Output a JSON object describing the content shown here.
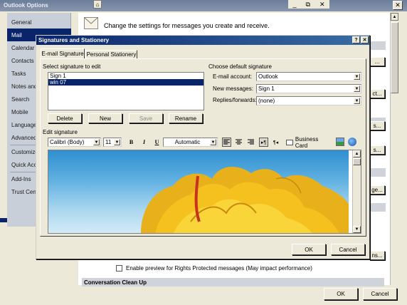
{
  "outer": {
    "title": "Outlook Options",
    "header_text": "Change the settings for messages you create and receive.",
    "nav": [
      "General",
      "Mail",
      "Calendar",
      "Contacts",
      "Tasks",
      "Notes and Journal",
      "Search",
      "Mobile",
      "Language",
      "Advanced",
      "Customize Ribbon",
      "Quick Access Toolbar",
      "Add-Ins",
      "Trust Center"
    ],
    "preview_label": "Enable preview for Rights Protected messages (May impact performance)",
    "section_cleanup": "Conversation Clean Up",
    "ok": "OK",
    "cancel": "Cancel",
    "right_buttons": [
      "...",
      "ct...",
      "s...",
      "s...",
      "ge...",
      "ns..."
    ]
  },
  "dialog": {
    "title": "Signatures and Stationery",
    "tabs": [
      "E-mail Signature",
      "Personal Stationery"
    ],
    "select_label": "Select signature to edit",
    "signatures": [
      "Sign 1",
      "win 07"
    ],
    "selected_index": 1,
    "buttons": {
      "delete": "Delete",
      "new": "New",
      "save": "Save",
      "rename": "Rename"
    },
    "default_label": "Choose default signature",
    "email_account_label": "E-mail account:",
    "email_account_value": "Outlook",
    "new_messages_label": "New messages:",
    "new_messages_value": "Sign 1",
    "replies_label": "Replies/forwards:",
    "replies_value": "(none)",
    "edit_label": "Edit signature",
    "font_name": "Calibri (Body)",
    "font_size": "11",
    "color_value": "Automatic",
    "business_card": "Business Card",
    "ok": "OK",
    "cancel": "Cancel"
  },
  "colors": {
    "nav_selected": "#0a246a",
    "title_bar": "#0a246a",
    "dialog_bg": "#ece9d8",
    "nav_bg": "#c9cfd8"
  }
}
